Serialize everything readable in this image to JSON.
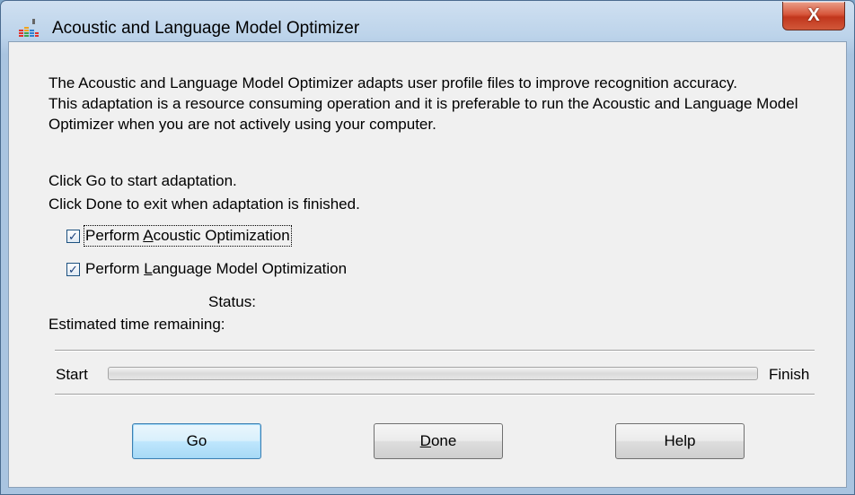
{
  "window": {
    "title": "Acoustic and Language Model Optimizer",
    "close_glyph": "X"
  },
  "content": {
    "description_line1": "The Acoustic and Language Model Optimizer adapts user profile files to improve recognition accuracy.",
    "description_line2": "This adaptation is a resource consuming operation and it is preferable to run the Acoustic and Language Model Optimizer when you are not actively using your computer.",
    "go_hint": "Click Go to start adaptation.",
    "done_hint": "Click Done to exit when adaptation is finished."
  },
  "options": {
    "acoustic": {
      "label_pre": "Perform ",
      "label_key": "A",
      "label_post": "coustic Optimization",
      "checked": true
    },
    "language": {
      "label_pre": "Perform ",
      "label_key": "L",
      "label_post": "anguage Model Optimization",
      "checked": true
    }
  },
  "status": {
    "status_label": "Status:",
    "time_label": "Estimated time remaining:"
  },
  "progress": {
    "start_label": "Start",
    "finish_label": "Finish",
    "value_fraction": 0
  },
  "buttons": {
    "go": {
      "label": "Go"
    },
    "done": {
      "label_key": "D",
      "label_rest": "one"
    },
    "help": {
      "label": "Help"
    }
  },
  "colors": {
    "checkmark": "#1a3f7a",
    "close_button": "#c1361c",
    "default_button_border": "#3c7fb1"
  }
}
